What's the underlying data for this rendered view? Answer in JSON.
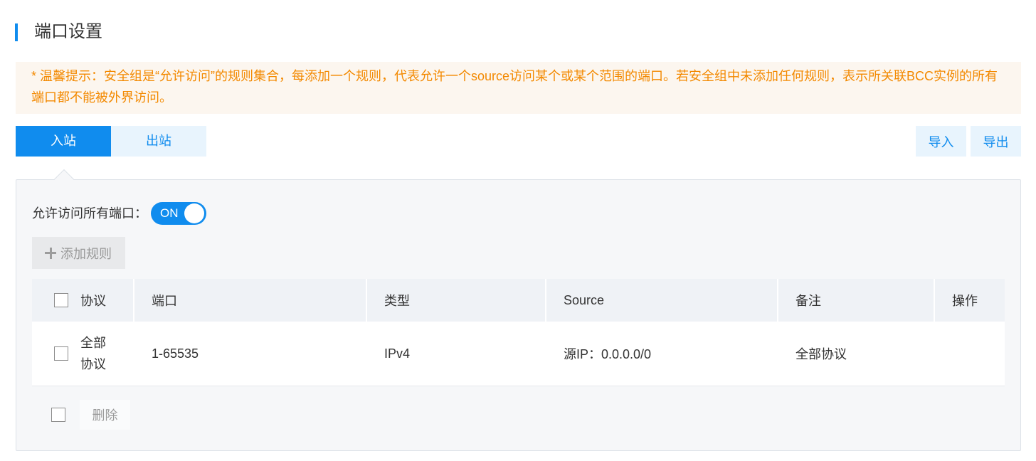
{
  "page": {
    "title": "端口设置"
  },
  "notice": {
    "text": "* 温馨提示：安全组是“允许访问”的规则集合，每添加一个规则，代表允许一个source访问某个或某个范围的端口。若安全组中未添加任何规则，表示所关联BCC实例的所有端口都不能被外界访问。"
  },
  "tabs": [
    {
      "label": "入站",
      "active": true
    },
    {
      "label": "出站",
      "active": false
    }
  ],
  "actions": {
    "import_label": "导入",
    "export_label": "导出"
  },
  "panel": {
    "allow_all_label": "允许访问所有端口：",
    "toggle": {
      "label": "ON",
      "on": true
    },
    "add_rule": {
      "label": "添加规则",
      "icon": "plus-icon",
      "disabled": true
    },
    "table": {
      "columns": [
        "协议",
        "端口",
        "类型",
        "Source",
        "备注",
        "操作"
      ],
      "rows": [
        {
          "protocol": "全部协议",
          "port": "1-65535",
          "type": "IPv4",
          "source": "源IP：0.0.0.0/0",
          "remark": "全部协议"
        }
      ]
    },
    "footer": {
      "delete_label": "删除",
      "disabled": true
    }
  },
  "colors": {
    "accent": "#108cee",
    "accent_light": "#e8f4fd",
    "notice_text": "#f38900",
    "notice_bg": "#fcf6ef",
    "disabled_text": "#999999"
  }
}
